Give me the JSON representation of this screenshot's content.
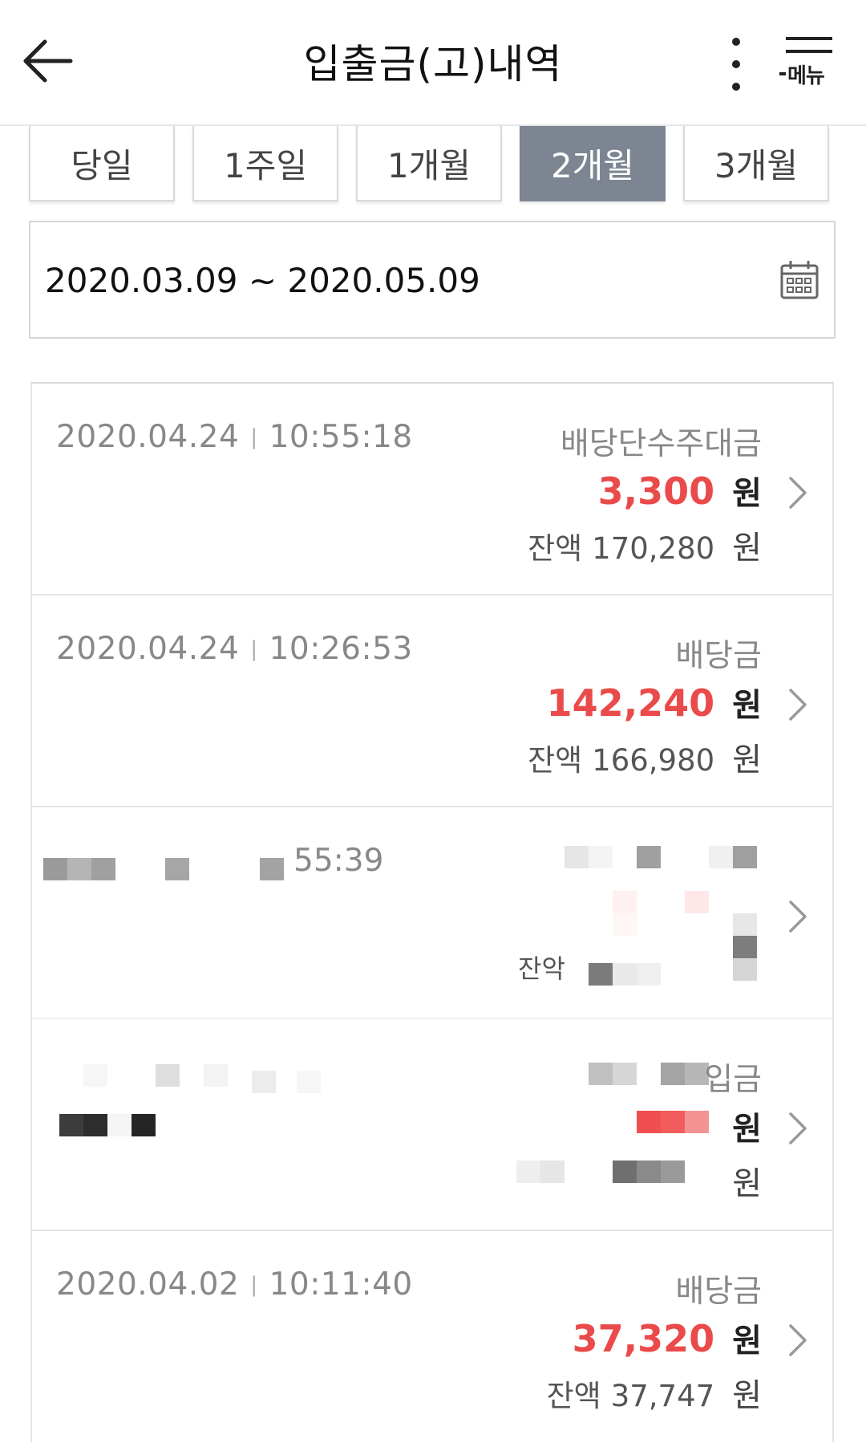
{
  "header": {
    "title": "입출금(고)내역",
    "menu_label": "메뉴",
    "back_icon": "arrow-left-icon",
    "more_icon": "vertical-dots-icon",
    "menu_icon": "hamburger-icon"
  },
  "tabs": [
    {
      "label": "당일",
      "active": false
    },
    {
      "label": "1주일",
      "active": false
    },
    {
      "label": "1개월",
      "active": false
    },
    {
      "label": "2개월",
      "active": true
    },
    {
      "label": "3개월",
      "active": false
    }
  ],
  "date_range": {
    "text": "2020.03.09 ~ 2020.05.09",
    "icon": "calendar-icon"
  },
  "transactions": [
    {
      "date": "2020.04.24",
      "sep": "|",
      "time": "10:55:18",
      "type": "배당단수주대금",
      "amount": "3,300",
      "unit": "원",
      "balance_label": "잔액",
      "balance": "170,280",
      "balance_unit": "원"
    },
    {
      "date": "2020.04.24",
      "sep": "|",
      "time": "10:26:53",
      "type": "배당금",
      "amount": "142,240",
      "unit": "원",
      "balance_label": "잔액",
      "balance": "166,980",
      "balance_unit": "원"
    },
    {
      "time_partial": "55:39",
      "balance_label": "잔악",
      "redacted": true
    },
    {
      "type_partial": "입금",
      "unit": "원",
      "balance_unit": "원",
      "redacted": true
    },
    {
      "date": "2020.04.02",
      "sep": "|",
      "time": "10:11:40",
      "type": "배당금",
      "amount": "37,320",
      "unit": "원",
      "balance_label": "잔액",
      "balance": "37,747",
      "balance_unit": "원"
    }
  ],
  "colors": {
    "accent_tab": "#7c8591",
    "amount_red": "#ea4a4a",
    "muted_text": "#888888"
  }
}
